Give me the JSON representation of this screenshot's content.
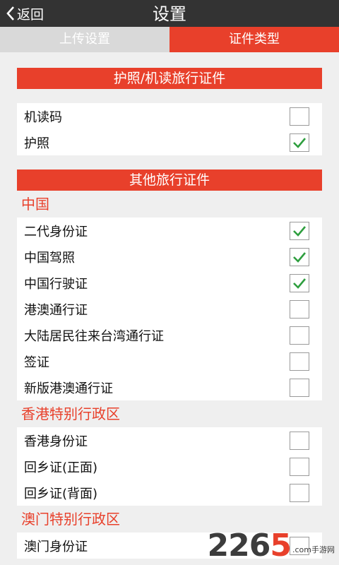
{
  "header": {
    "back_label": "返回",
    "title": "设置"
  },
  "tabs": [
    {
      "label": "上传设置",
      "active": false
    },
    {
      "label": "证件类型",
      "active": true
    }
  ],
  "sections": {
    "passport": {
      "title": "护照/机读旅行证件",
      "items": [
        {
          "label": "机读码",
          "checked": false
        },
        {
          "label": "护照",
          "checked": true
        }
      ]
    },
    "other": {
      "title": "其他旅行证件",
      "regions": [
        {
          "name": "中国",
          "items": [
            {
              "label": "二代身份证",
              "checked": true
            },
            {
              "label": "中国驾照",
              "checked": true
            },
            {
              "label": "中国行驶证",
              "checked": true
            },
            {
              "label": "港澳通行证",
              "checked": false
            },
            {
              "label": "大陆居民往来台湾通行证",
              "checked": false
            },
            {
              "label": "签证",
              "checked": false
            },
            {
              "label": "新版港澳通行证",
              "checked": false
            }
          ]
        },
        {
          "name": "香港特别行政区",
          "items": [
            {
              "label": "香港身份证",
              "checked": false
            },
            {
              "label": "回乡证(正面)",
              "checked": false
            },
            {
              "label": "回乡证(背面)",
              "checked": false
            }
          ]
        },
        {
          "name": "澳门特别行政区",
          "items": [
            {
              "label": "澳门身份证",
              "checked": false
            }
          ]
        }
      ]
    }
  },
  "watermark": {
    "digits_a": "226",
    "digits_b": "5",
    "text": ".com手游网"
  },
  "colors": {
    "accent": "#e8402b",
    "header": "#333333",
    "check": "#2e9e3e"
  }
}
